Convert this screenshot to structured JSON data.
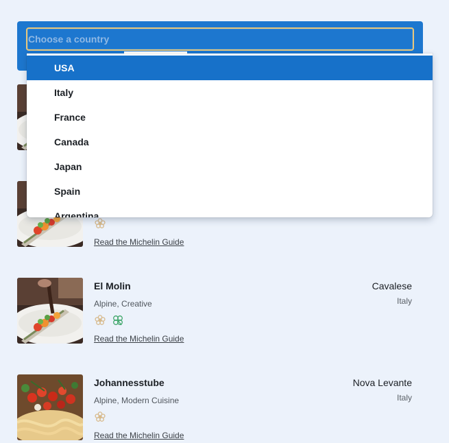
{
  "country_select": {
    "placeholder": "Choose a country",
    "options": [
      "USA",
      "Italy",
      "France",
      "Canada",
      "Japan",
      "Spain",
      "Argentina"
    ],
    "highlighted": "USA"
  },
  "restaurants": [
    {
      "name": "",
      "cuisine": "",
      "city": "",
      "country": "",
      "awards": [],
      "link_label": "",
      "thumb_icon": "dessert-plate-photo"
    },
    {
      "name": "",
      "cuisine": "",
      "city": "",
      "country": "",
      "awards": [
        "michelin-star-icon"
      ],
      "link_label": "Read the Michelin Guide",
      "thumb_icon": "dessert-plate-photo"
    },
    {
      "name": "El Molin",
      "cuisine": "Alpine, Creative",
      "city": "Cavalese",
      "country": "Italy",
      "awards": [
        "michelin-star-icon",
        "green-star-icon"
      ],
      "link_label": "Read the Michelin Guide",
      "thumb_icon": "dessert-plate-photo"
    },
    {
      "name": "Johannesstube",
      "cuisine": "Alpine, Modern Cuisine",
      "city": "Nova Levante",
      "country": "Italy",
      "awards": [
        "michelin-star-icon"
      ],
      "link_label": "Read the Michelin Guide",
      "thumb_icon": "pasta-tomato-photo"
    }
  ],
  "colors": {
    "page_bg": "#ecf2fb",
    "accent": "#1d77cf",
    "highlight": "#1771c9",
    "focus_ring": "#e9c77b",
    "michelin_star": "#d7b98a",
    "green_star": "#3fa66a"
  }
}
